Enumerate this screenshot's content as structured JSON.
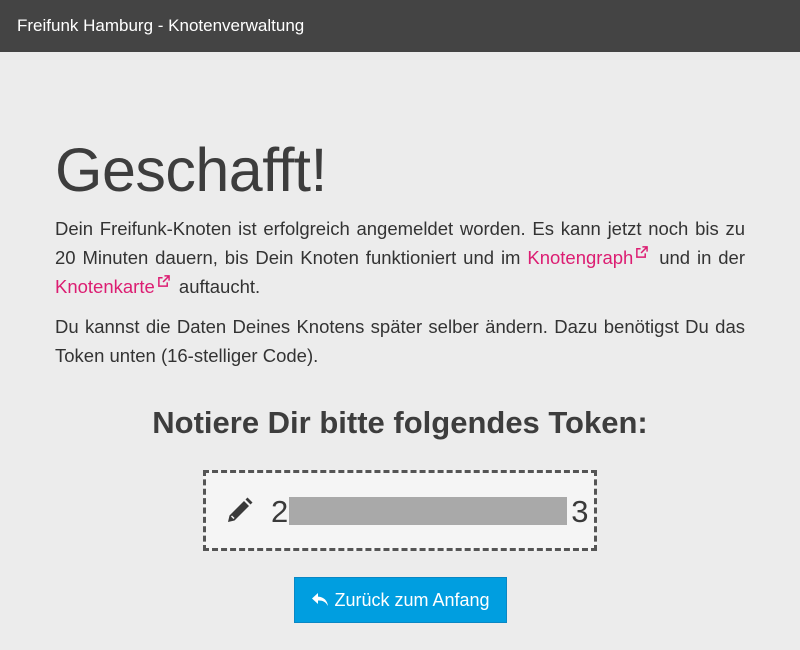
{
  "navbar": {
    "title": "Freifunk Hamburg - Knotenverwaltung"
  },
  "main": {
    "heading": "Geschafft!",
    "paragraph1": {
      "text_before": "Dein Freifunk-Knoten ist erfolgreich angemeldet worden. Es kann jetzt noch bis zu 20 Minuten dauern, bis Dein Knoten funktioniert und im ",
      "link1_label": "Knotengraph",
      "text_middle": " und in der ",
      "link2_label": "Knotenkarte",
      "text_after": " auftaucht."
    },
    "paragraph2": "Du kannst die Daten Deines Knotens später selber ändern. Dazu benötigst Du das Token unten (16-stelliger Code).",
    "token_heading": "Notiere Dir bitte folgendes Token:",
    "token": {
      "visible_start": "2",
      "visible_end": "3",
      "icon": "pencil-icon"
    },
    "back_button_label": "Zurück zum Anfang"
  },
  "colors": {
    "navbar_bg": "#444444",
    "page_bg": "#ececec",
    "link": "#dc1d72",
    "button_bg": "#009ee0"
  }
}
